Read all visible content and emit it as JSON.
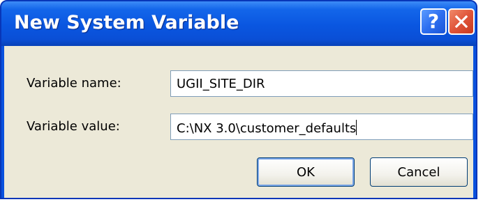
{
  "window": {
    "title": "New System Variable",
    "help_icon": "help-icon",
    "close_icon": "close-icon"
  },
  "form": {
    "name_label": "Variable name:",
    "name_value": "UGII_SITE_DIR",
    "value_label": "Variable value:",
    "value_value": "C:\\NX 3.0\\customer_defaults"
  },
  "buttons": {
    "ok_label": "OK",
    "cancel_label": "Cancel"
  },
  "colors": {
    "titlebar": "#0a56e0",
    "dialog_bg": "#ece9d8",
    "close_button": "#e0553a"
  }
}
